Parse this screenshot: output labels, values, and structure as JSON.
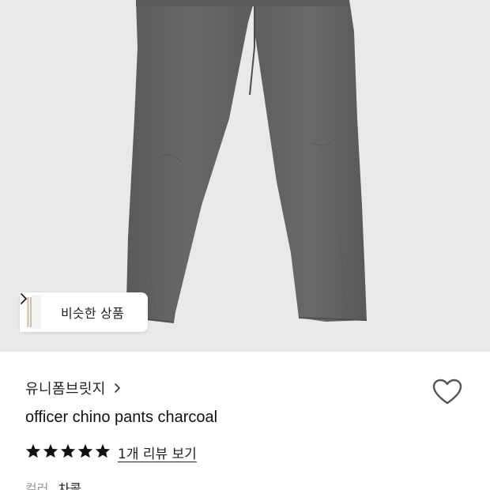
{
  "product_image": {
    "background_color": "#e9e9eb",
    "pants_color": "#616161",
    "similar_button": {
      "label": "비슷한 상품",
      "icon": "chevron-right-icon"
    }
  },
  "product": {
    "brand": "유니폼브릿지",
    "brand_icon": "chevron-right-icon",
    "title": "officer chino pants charcoal",
    "like_icon": "heart-outline-icon",
    "rating_stars": 5,
    "review_link": "1개 리뷰 보기",
    "option_label": "컬러",
    "option_value": "차콜"
  }
}
